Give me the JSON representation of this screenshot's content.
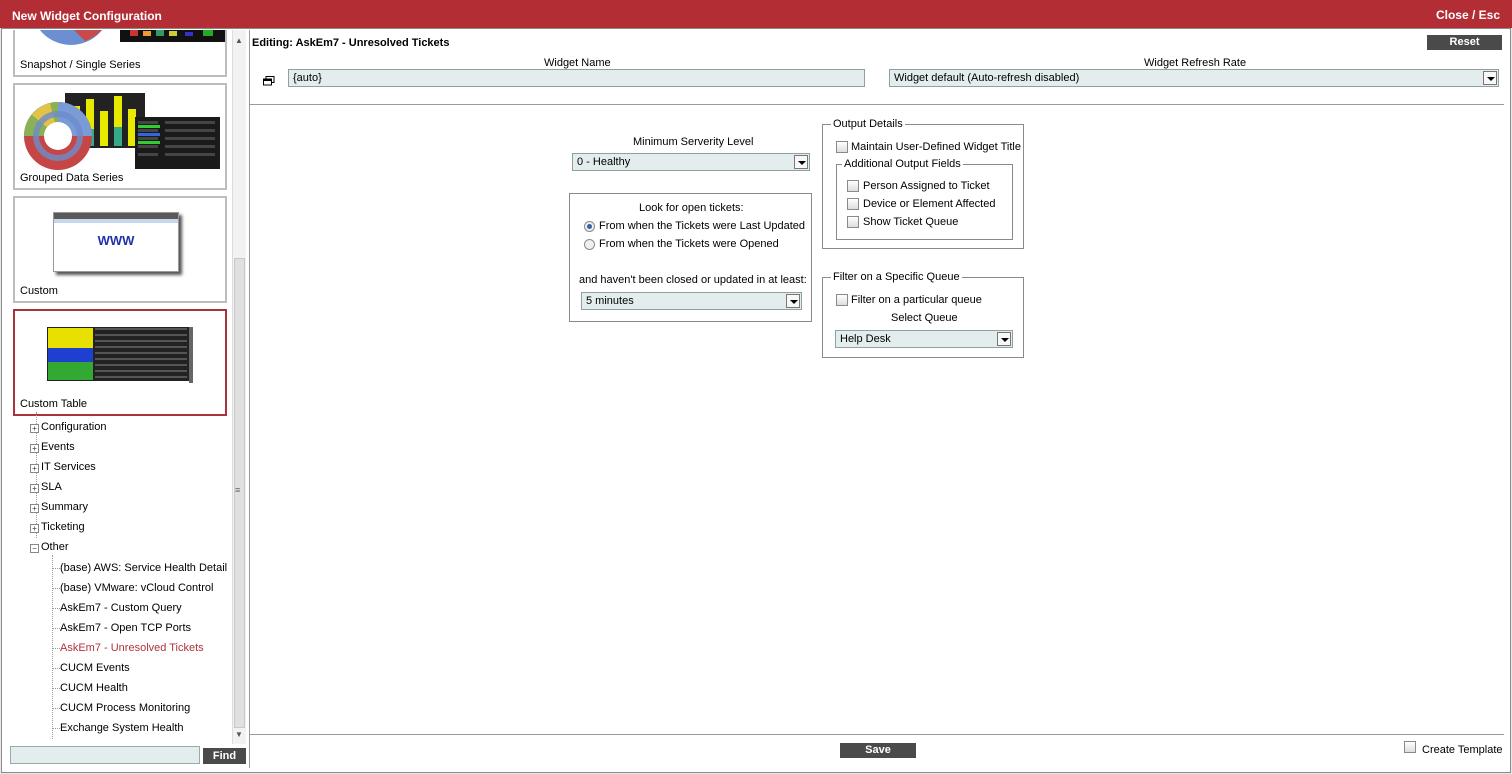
{
  "window": {
    "title": "New Widget Configuration",
    "close_label": "Close / Esc"
  },
  "tiles": [
    {
      "caption": "Snapshot / Single Series"
    },
    {
      "caption": "Grouped Data Series"
    },
    {
      "caption": "Custom",
      "thumb_text": "WWW"
    },
    {
      "caption": "Custom Table"
    }
  ],
  "tree": {
    "nodes": [
      "Configuration",
      "Events",
      "IT Services",
      "SLA",
      "Summary",
      "Ticketing",
      "Other"
    ],
    "collapsed_sign": "+",
    "expanded_sign": "−",
    "leaves": [
      "(base) AWS: Service Health Detail",
      "(base) VMware: vCloud Control",
      "AskEm7 - Custom Query",
      "AskEm7 - Open TCP Ports",
      "AskEm7 - Unresolved Tickets",
      "CUCM Events",
      "CUCM Health",
      "CUCM Process Monitoring",
      "Exchange System Health"
    ],
    "active_leaf": "AskEm7 - Unresolved Tickets"
  },
  "find": {
    "value": "",
    "button_label": "Find"
  },
  "editor": {
    "header": "Editing: AskEm7 - Unresolved Tickets",
    "reset_label": "Reset",
    "widget_name_label": "Widget Name",
    "widget_name_value": "{auto}",
    "refresh_label": "Widget Refresh Rate",
    "refresh_value": "Widget default (Auto-refresh disabled)",
    "min_severity_label": "Minimum Serverity Level",
    "min_severity_value": "0 - Healthy",
    "look_for_label": "Look for open tickets:",
    "radio_last_updated": "From when the Tickets were Last Updated",
    "radio_opened": "From when the Tickets were Opened",
    "not_closed_label": "and haven't been closed or updated in at least:",
    "interval_value": "5 minutes",
    "output_details_legend": "Output Details",
    "maintain_title_label": "Maintain User-Defined Widget Title",
    "additional_fields_legend": "Additional Output Fields",
    "person_assigned_label": "Person Assigned to Ticket",
    "device_affected_label": "Device or Element Affected",
    "show_queue_label": "Show Ticket Queue",
    "filter_queue_legend": "Filter on a Specific Queue",
    "filter_particular_label": "Filter on a particular queue",
    "select_queue_label": "Select Queue",
    "queue_value": "Help Desk",
    "save_label": "Save",
    "create_template_label": "Create Template"
  }
}
